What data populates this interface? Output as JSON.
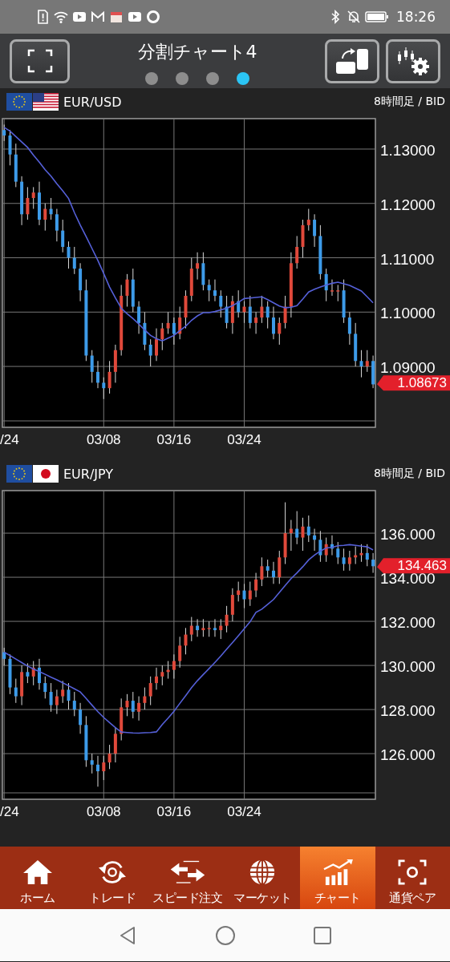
{
  "status_bar": {
    "time": "18:26"
  },
  "header": {
    "title": "分割チャート4",
    "pages": [
      {
        "selected": false
      },
      {
        "selected": false
      },
      {
        "selected": false
      },
      {
        "selected": true
      }
    ]
  },
  "charts": [
    {
      "pair": "EUR/USD",
      "timeframe": "8時間足 / BID",
      "last_price": "1.08673",
      "chart_data": {
        "type": "candlestick",
        "grid": true,
        "ylim": [
          1.0788,
          1.1356
        ],
        "yticks": [
          {
            "value": 1.13,
            "label": "1.13000"
          },
          {
            "value": 1.12,
            "label": "1.12000"
          },
          {
            "value": 1.11,
            "label": "1.11000"
          },
          {
            "value": 1.1,
            "label": "1.10000"
          },
          {
            "value": 1.09,
            "label": "1.09000"
          }
        ],
        "categories": [
          "/24",
          null,
          null,
          null,
          null,
          null,
          null,
          null,
          null,
          null,
          null,
          null,
          null,
          null,
          null,
          null,
          null,
          "03/08",
          null,
          null,
          null,
          null,
          null,
          null,
          null,
          null,
          null,
          null,
          null,
          "03/16",
          null,
          null,
          null,
          null,
          null,
          null,
          null,
          null,
          null,
          null,
          null,
          "03/24",
          null,
          null,
          null,
          null,
          null,
          null,
          null,
          null,
          null,
          null,
          null,
          null,
          null,
          null,
          null,
          null,
          null,
          null,
          null,
          null,
          null,
          null
        ],
        "ohlc": [
          [
            1.1335,
            1.1345,
            1.1315,
            1.1325
          ],
          [
            1.1325,
            1.1335,
            1.127,
            1.129
          ],
          [
            1.129,
            1.131,
            1.123,
            1.124
          ],
          [
            1.124,
            1.125,
            1.116,
            1.118
          ],
          [
            1.118,
            1.123,
            1.117,
            1.121
          ],
          [
            1.121,
            1.123,
            1.119,
            1.122
          ],
          [
            1.122,
            1.124,
            1.116,
            1.117
          ],
          [
            1.117,
            1.12,
            1.115,
            1.119
          ],
          [
            1.119,
            1.121,
            1.117,
            1.118
          ],
          [
            1.118,
            1.119,
            1.113,
            1.115
          ],
          [
            1.115,
            1.117,
            1.111,
            1.112
          ],
          [
            1.112,
            1.113,
            1.108,
            1.11
          ],
          [
            1.11,
            1.112,
            1.107,
            1.108
          ],
          [
            1.108,
            1.109,
            1.102,
            1.104
          ],
          [
            1.104,
            1.106,
            1.091,
            1.092
          ],
          [
            1.092,
            1.093,
            1.087,
            1.089
          ],
          [
            1.089,
            1.091,
            1.086,
            1.087
          ],
          [
            1.087,
            1.088,
            1.084,
            1.086
          ],
          [
            1.086,
            1.091,
            1.085,
            1.089
          ],
          [
            1.089,
            1.094,
            1.087,
            1.093
          ],
          [
            1.093,
            1.105,
            1.092,
            1.103
          ],
          [
            1.103,
            1.107,
            1.101,
            1.106
          ],
          [
            1.106,
            1.108,
            1.1,
            1.101
          ],
          [
            1.101,
            1.102,
            1.096,
            1.098
          ],
          [
            1.098,
            1.1,
            1.093,
            1.094
          ],
          [
            1.094,
            1.095,
            1.09,
            1.092
          ],
          [
            1.092,
            1.097,
            1.091,
            1.095
          ],
          [
            1.095,
            1.098,
            1.093,
            1.097
          ],
          [
            1.097,
            1.1,
            1.096,
            1.098
          ],
          [
            1.098,
            1.099,
            1.094,
            1.096
          ],
          [
            1.096,
            1.101,
            1.095,
            1.099
          ],
          [
            1.099,
            1.104,
            1.097,
            1.103
          ],
          [
            1.103,
            1.11,
            1.102,
            1.108
          ],
          [
            1.108,
            1.111,
            1.106,
            1.109
          ],
          [
            1.109,
            1.111,
            1.104,
            1.105
          ],
          [
            1.105,
            1.106,
            1.102,
            1.104
          ],
          [
            1.104,
            1.106,
            1.102,
            1.103
          ],
          [
            1.103,
            1.104,
            1.099,
            1.101
          ],
          [
            1.101,
            1.103,
            1.097,
            1.098
          ],
          [
            1.098,
            1.103,
            1.096,
            1.102
          ],
          [
            1.102,
            1.104,
            1.099,
            1.1
          ],
          [
            1.1,
            1.102,
            1.098,
            1.101
          ],
          [
            1.101,
            1.103,
            1.097,
            1.098
          ],
          [
            1.098,
            1.1,
            1.096,
            1.099
          ],
          [
            1.099,
            1.103,
            1.098,
            1.101
          ],
          [
            1.101,
            1.102,
            1.097,
            1.099
          ],
          [
            1.099,
            1.101,
            1.095,
            1.096
          ],
          [
            1.096,
            1.099,
            1.094,
            1.098
          ],
          [
            1.098,
            1.103,
            1.097,
            1.101
          ],
          [
            1.101,
            1.111,
            1.099,
            1.109
          ],
          [
            1.109,
            1.114,
            1.108,
            1.112
          ],
          [
            1.112,
            1.117,
            1.11,
            1.116
          ],
          [
            1.116,
            1.119,
            1.115,
            1.117
          ],
          [
            1.117,
            1.118,
            1.112,
            1.114
          ],
          [
            1.114,
            1.116,
            1.106,
            1.107
          ],
          [
            1.107,
            1.108,
            1.102,
            1.104
          ],
          [
            1.104,
            1.106,
            1.103,
            1.104
          ],
          [
            1.104,
            1.105,
            1.102,
            1.104
          ],
          [
            1.104,
            1.106,
            1.098,
            1.099
          ],
          [
            1.099,
            1.1,
            1.094,
            1.096
          ],
          [
            1.096,
            1.098,
            1.09,
            1.091
          ],
          [
            1.091,
            1.093,
            1.088,
            1.09
          ],
          [
            1.09,
            1.093,
            1.089,
            1.091
          ],
          [
            1.091,
            1.092,
            1.086,
            1.0867
          ]
        ],
        "series": [
          {
            "type": "line",
            "color": "#5560d8",
            "values": [
              1.134,
              1.1333,
              1.1323,
              1.1313,
              1.1303,
              1.1289,
              1.1276,
              1.1262,
              1.125,
              1.1236,
              1.1223,
              1.1209,
              1.1183,
              1.116,
              1.1139,
              1.1117,
              1.1095,
              1.1071,
              1.1046,
              1.1026,
              1.1007,
              1.0997,
              1.0988,
              1.0978,
              1.0967,
              1.0957,
              1.0951,
              1.0947,
              1.0952,
              1.0957,
              1.0966,
              1.0974,
              1.0985,
              1.0993,
              1.0999,
              1.0999,
              1.1001,
              1.1004,
              1.1007,
              1.1012,
              1.1018,
              1.1025,
              1.1026,
              1.1027,
              1.1028,
              1.1023,
              1.1017,
              1.1011,
              1.1008,
              1.1009,
              1.1012,
              1.1024,
              1.1037,
              1.1042,
              1.1046,
              1.105,
              1.1053,
              1.1055,
              1.1052,
              1.1049,
              1.1044,
              1.1039,
              1.1028,
              1.1017
            ]
          }
        ]
      }
    },
    {
      "pair": "EUR/JPY",
      "timeframe": "8時間足 / BID",
      "last_price": "134.463",
      "chart_data": {
        "type": "candlestick",
        "grid": true,
        "ylim": [
          123.93,
          137.93
        ],
        "yticks": [
          {
            "value": 136,
            "label": "136.000"
          },
          {
            "value": 134,
            "label": "134.000"
          },
          {
            "value": 132,
            "label": "132.000"
          },
          {
            "value": 130,
            "label": "130.000"
          },
          {
            "value": 128,
            "label": "128.000"
          },
          {
            "value": 126,
            "label": "126.000"
          }
        ],
        "categories": [
          "/24",
          null,
          null,
          null,
          null,
          null,
          null,
          null,
          null,
          null,
          null,
          null,
          null,
          null,
          null,
          null,
          null,
          "03/08",
          null,
          null,
          null,
          null,
          null,
          null,
          null,
          null,
          null,
          null,
          null,
          "03/16",
          null,
          null,
          null,
          null,
          null,
          null,
          null,
          null,
          null,
          null,
          null,
          "03/24",
          null,
          null,
          null,
          null,
          null,
          null,
          null,
          null,
          null,
          null,
          null,
          null,
          null,
          null,
          null,
          null,
          null,
          null,
          null,
          null,
          null,
          null
        ],
        "ohlc": [
          [
            130.6,
            130.8,
            130,
            130.3
          ],
          [
            130.3,
            130.5,
            128.7,
            129
          ],
          [
            129,
            129.4,
            128.3,
            128.6
          ],
          [
            128.6,
            130,
            128.2,
            129.7
          ],
          [
            129.7,
            130.1,
            129.2,
            129.5
          ],
          [
            129.5,
            130.2,
            129.1,
            129.9
          ],
          [
            129.9,
            130.3,
            128.9,
            129.2
          ],
          [
            129.2,
            129.5,
            128.5,
            128.8
          ],
          [
            128.8,
            129.2,
            127.9,
            128.2
          ],
          [
            128.2,
            128.9,
            127.8,
            128.6
          ],
          [
            128.6,
            129.3,
            128.3,
            128.9
          ],
          [
            128.9,
            129.2,
            128,
            128.4
          ],
          [
            128.4,
            128.8,
            127.7,
            128
          ],
          [
            128,
            128.3,
            126.9,
            127.3
          ],
          [
            127.3,
            127.7,
            125.4,
            125.7
          ],
          [
            125.7,
            126,
            125.1,
            125.5
          ],
          [
            125.5,
            125.9,
            124.5,
            125.2
          ],
          [
            125.2,
            125.9,
            124.8,
            125.6
          ],
          [
            125.6,
            126.4,
            125.3,
            126
          ],
          [
            126,
            127.2,
            125.6,
            126.9
          ],
          [
            126.9,
            128.5,
            126.6,
            128.1
          ],
          [
            128.1,
            128.7,
            127.7,
            128.4
          ],
          [
            128.4,
            128.8,
            127.6,
            127.9
          ],
          [
            127.9,
            128.6,
            127.5,
            128.3
          ],
          [
            128.3,
            129,
            128,
            128.6
          ],
          [
            128.6,
            129.5,
            128.2,
            129.2
          ],
          [
            129.2,
            129.9,
            128.9,
            129.5
          ],
          [
            129.5,
            130,
            129.1,
            129.7
          ],
          [
            129.7,
            130.2,
            129.4,
            129.8
          ],
          [
            129.8,
            130.5,
            129.4,
            130.2
          ],
          [
            130.2,
            131.3,
            129.9,
            130.9
          ],
          [
            130.9,
            131.7,
            130.5,
            131.4
          ],
          [
            131.4,
            132.2,
            131.1,
            131.8
          ],
          [
            131.8,
            132.1,
            131.3,
            131.6
          ],
          [
            131.6,
            132.1,
            131.3,
            131.7
          ],
          [
            131.7,
            132,
            131.3,
            131.7
          ],
          [
            131.7,
            132.1,
            131.3,
            131.6
          ],
          [
            131.6,
            132.1,
            131.2,
            131.8
          ],
          [
            131.8,
            132.7,
            131.5,
            132.3
          ],
          [
            132.3,
            133.5,
            132,
            133.2
          ],
          [
            133.2,
            133.8,
            132.9,
            133.4
          ],
          [
            133.4,
            133.7,
            132.6,
            133
          ],
          [
            133,
            133.8,
            132.7,
            133.4
          ],
          [
            133.4,
            134.2,
            133.1,
            133.9
          ],
          [
            133.9,
            134.9,
            133.6,
            134.5
          ],
          [
            134.5,
            134.8,
            134,
            134.3
          ],
          [
            134.3,
            134.7,
            133.7,
            134
          ],
          [
            134,
            135.2,
            133.7,
            134.9
          ],
          [
            134.9,
            137.4,
            134.6,
            136
          ],
          [
            136,
            136.6,
            135.2,
            136.2
          ],
          [
            136.2,
            137,
            135.5,
            135.8
          ],
          [
            135.8,
            136.7,
            135.2,
            136.3
          ],
          [
            136.3,
            136.8,
            135.6,
            135.9
          ],
          [
            135.9,
            136.2,
            135.2,
            135.7
          ],
          [
            135.7,
            136.1,
            134.7,
            135
          ],
          [
            135,
            135.8,
            134.7,
            135.5
          ],
          [
            135.5,
            135.9,
            135,
            135.3
          ],
          [
            135.3,
            135.6,
            134.6,
            134.9
          ],
          [
            134.9,
            135.3,
            134.3,
            134.6
          ],
          [
            134.6,
            135.2,
            134.3,
            134.9
          ],
          [
            134.9,
            135.4,
            134.6,
            135
          ],
          [
            135,
            135.5,
            134.7,
            135.1
          ],
          [
            135.1,
            135.5,
            134.5,
            134.8
          ],
          [
            134.8,
            135.1,
            134.2,
            134.5
          ]
        ],
        "series": [
          {
            "type": "line",
            "color": "#5560d8",
            "values": [
              130.6,
              130.45,
              130.29,
              130.13,
              129.97,
              129.84,
              129.72,
              129.6,
              129.47,
              129.35,
              129.21,
              129.08,
              128.94,
              128.8,
              128.5,
              128.2,
              127.9,
              127.64,
              127.41,
              127.18,
              126.98,
              126.96,
              126.94,
              126.93,
              126.95,
              126.96,
              126.99,
              127.32,
              127.61,
              127.92,
              128.28,
              128.63,
              128.99,
              129.31,
              129.59,
              129.86,
              130.14,
              130.43,
              130.74,
              131.04,
              131.35,
              131.67,
              131.98,
              132.41,
              132.55,
              132.77,
              132.99,
              133.31,
              133.63,
              133.94,
              134.2,
              134.48,
              134.79,
              135.01,
              135.19,
              135.33,
              135.36,
              135.43,
              135.45,
              135.48,
              135.45,
              135.41,
              135.38,
              135.24
            ]
          }
        ]
      }
    }
  ],
  "nav": [
    {
      "label": "ホーム",
      "selected": false
    },
    {
      "label": "トレード",
      "selected": false
    },
    {
      "label": "スピード注文",
      "selected": false
    },
    {
      "label": "マーケット",
      "selected": false
    },
    {
      "label": "チャート",
      "selected": true
    },
    {
      "label": "通貨ペア",
      "selected": false
    }
  ]
}
